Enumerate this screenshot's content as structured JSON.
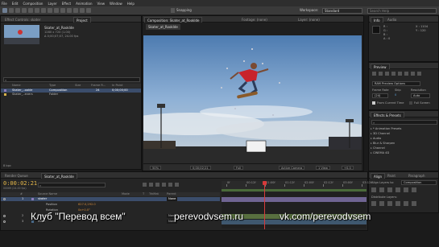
{
  "menu": [
    "File",
    "Edit",
    "Composition",
    "Layer",
    "Effect",
    "Animation",
    "View",
    "Window",
    "Help"
  ],
  "toolbar": {
    "snapping_label": "Snapping",
    "workspace_label": "Workspace:",
    "workspace_value": "Standard",
    "search_placeholder": "Search Help"
  },
  "project_panel": {
    "tabs": [
      "Effect Controls: skater",
      "Project"
    ],
    "active_tab": "Project",
    "preview_name": "Skater_at_Rooklde",
    "preview_info": [
      "1280 x 720 (1.00)",
      "Δ 0;00;07;07, 24.00 fps"
    ],
    "columns": [
      "Name",
      "Type",
      "Size",
      "Frame R...",
      "In Point"
    ],
    "items": [
      {
        "name": "Skater_..ookle",
        "type": "Composition",
        "size": "",
        "fps": "24",
        "in": "0;00;00;00",
        "color": "#8a7bb8",
        "selected": true
      },
      {
        "name": "Skater_..evers",
        "type": "Folder",
        "size": "",
        "fps": "",
        "in": "",
        "color": "#d6b24a",
        "selected": false
      }
    ],
    "footer_bpc": "8 bpc"
  },
  "composition_panel": {
    "tabs": [
      "Composition: Skater_at_Rooklde",
      "Footage: (none)",
      "Layer: (none)"
    ],
    "subtab": "Skater_at_Rooklde",
    "zoom": "50%",
    "timecode": "0;00;02;21",
    "resolution": "Full",
    "camera": "Active Camera",
    "views": "1 View",
    "exposure": "+0.0"
  },
  "info_panel": {
    "tabs": [
      "Info",
      "Audio"
    ],
    "lines": [
      "R :",
      "G :",
      "B :",
      "A : 0"
    ],
    "coords": [
      "X : 1104",
      "Y : 120"
    ]
  },
  "preview_panel": {
    "title": "Preview",
    "mode": "RAM Preview Options",
    "labels": [
      "Frame Rate",
      "Skip",
      "Resolution"
    ],
    "values": [
      "(24)",
      "0",
      "Auto"
    ],
    "checkboxes": [
      "From Current Time",
      "Full Screen"
    ]
  },
  "effects_panel": {
    "title": "Effects & Presets",
    "search_placeholder": "",
    "categories": [
      "* Animation Presets",
      "3D Channel",
      "Audio",
      "Blur & Sharpen",
      "Channel",
      "CINEMA 4D"
    ]
  },
  "align_panel": {
    "tabs": [
      "Align",
      "Paint",
      "Paragraph"
    ],
    "align_label": "Align Layers to:",
    "align_value": "Composition",
    "distribute_label": "Distribute Layers:"
  },
  "timeline": {
    "tabs": [
      "Render Queue",
      "Skater_at_Rooklde"
    ],
    "timecode": "0:00:02:21",
    "fps_note": "00069 (24.00 fps)",
    "columns": [
      "#",
      "Source Name",
      "Mode",
      "T",
      "TrkMat",
      "Parent"
    ],
    "layers": [
      {
        "num": "1",
        "name": "skater",
        "parent": "None",
        "selected": true
      },
      {
        "num": "",
        "name": "Position",
        "value": "627.0,292.0",
        "prop": true
      },
      {
        "num": "",
        "name": "Rotation",
        "value": "0x+0.0°",
        "prop": true
      },
      {
        "num": "2",
        "name": "screens",
        "parent": "None",
        "selected": false
      },
      {
        "num": "3",
        "name": "mask",
        "parent": "None",
        "selected": false
      }
    ],
    "ruler": [
      "0f",
      "00:12f",
      "01:00f",
      "01:12f",
      "02:00f",
      "02:12f",
      "03:00f",
      "03:12f"
    ],
    "playhead_position_label": "02:21"
  },
  "footer": {
    "club": "Клуб \"Перевод всем\"",
    "site": "perevodvsem.ru",
    "vk": "vk.com/perevodvsem"
  },
  "colors": {
    "accent": "#e6b84a",
    "playhead": "#d63a3a",
    "layer_bar_1": "#8a7bb8",
    "layer_bar_2": "#6b8a4a",
    "layer_bar_3": "#4a6b8a"
  }
}
